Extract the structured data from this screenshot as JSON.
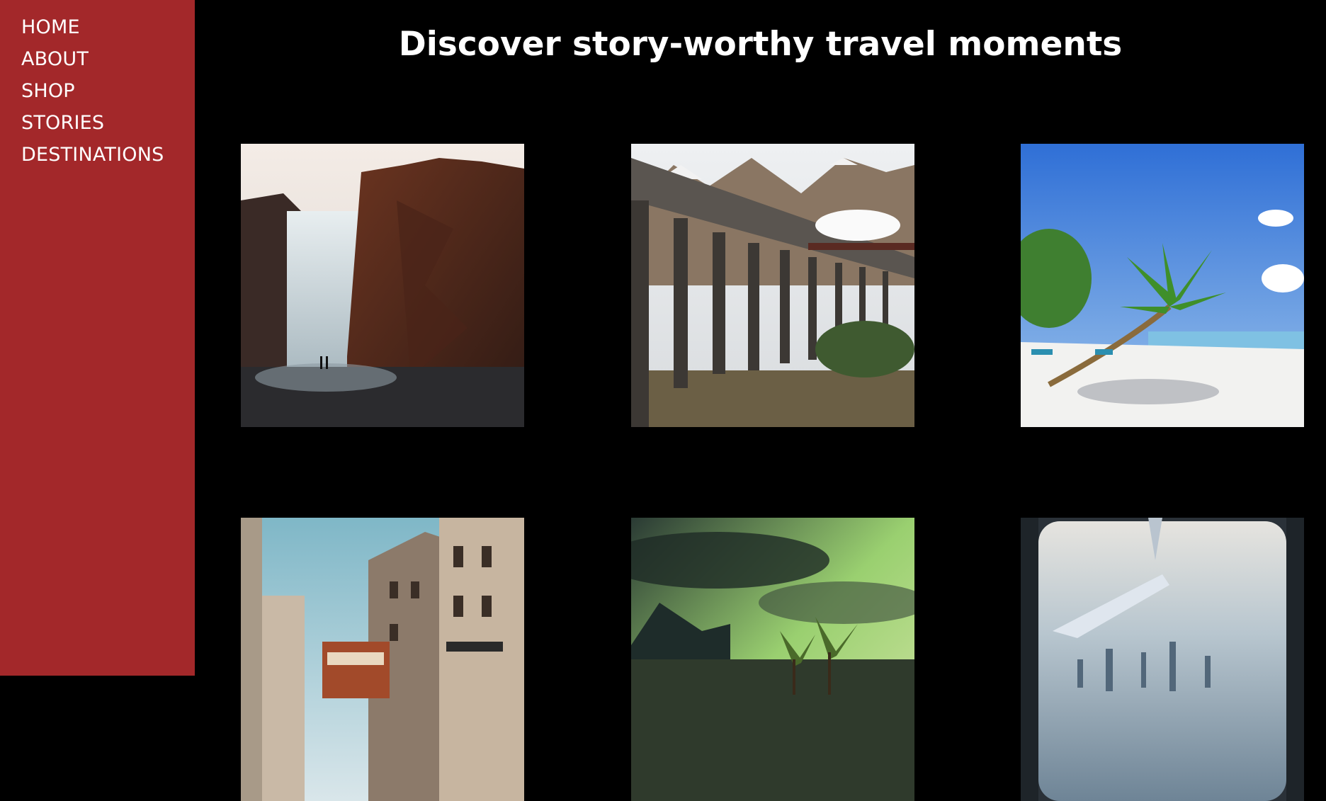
{
  "nav": {
    "items": [
      {
        "label": "HOME"
      },
      {
        "label": "ABOUT"
      },
      {
        "label": "SHOP"
      },
      {
        "label": "STORIES"
      },
      {
        "label": "DESTINATIONS"
      }
    ]
  },
  "header": {
    "title": "Discover story-worthy travel moments"
  },
  "gallery": {
    "photos": [
      {
        "subject": "waterfall-cliffs"
      },
      {
        "subject": "railway-viaduct-steam-train"
      },
      {
        "subject": "tropical-beach-palms"
      },
      {
        "subject": "city-street-tram"
      },
      {
        "subject": "stormy-sky-palm-harbor"
      },
      {
        "subject": "airplane-window-city-view"
      }
    ]
  },
  "colors": {
    "sidebar": "#a3282a",
    "background": "#000000",
    "text": "#ffffff"
  }
}
